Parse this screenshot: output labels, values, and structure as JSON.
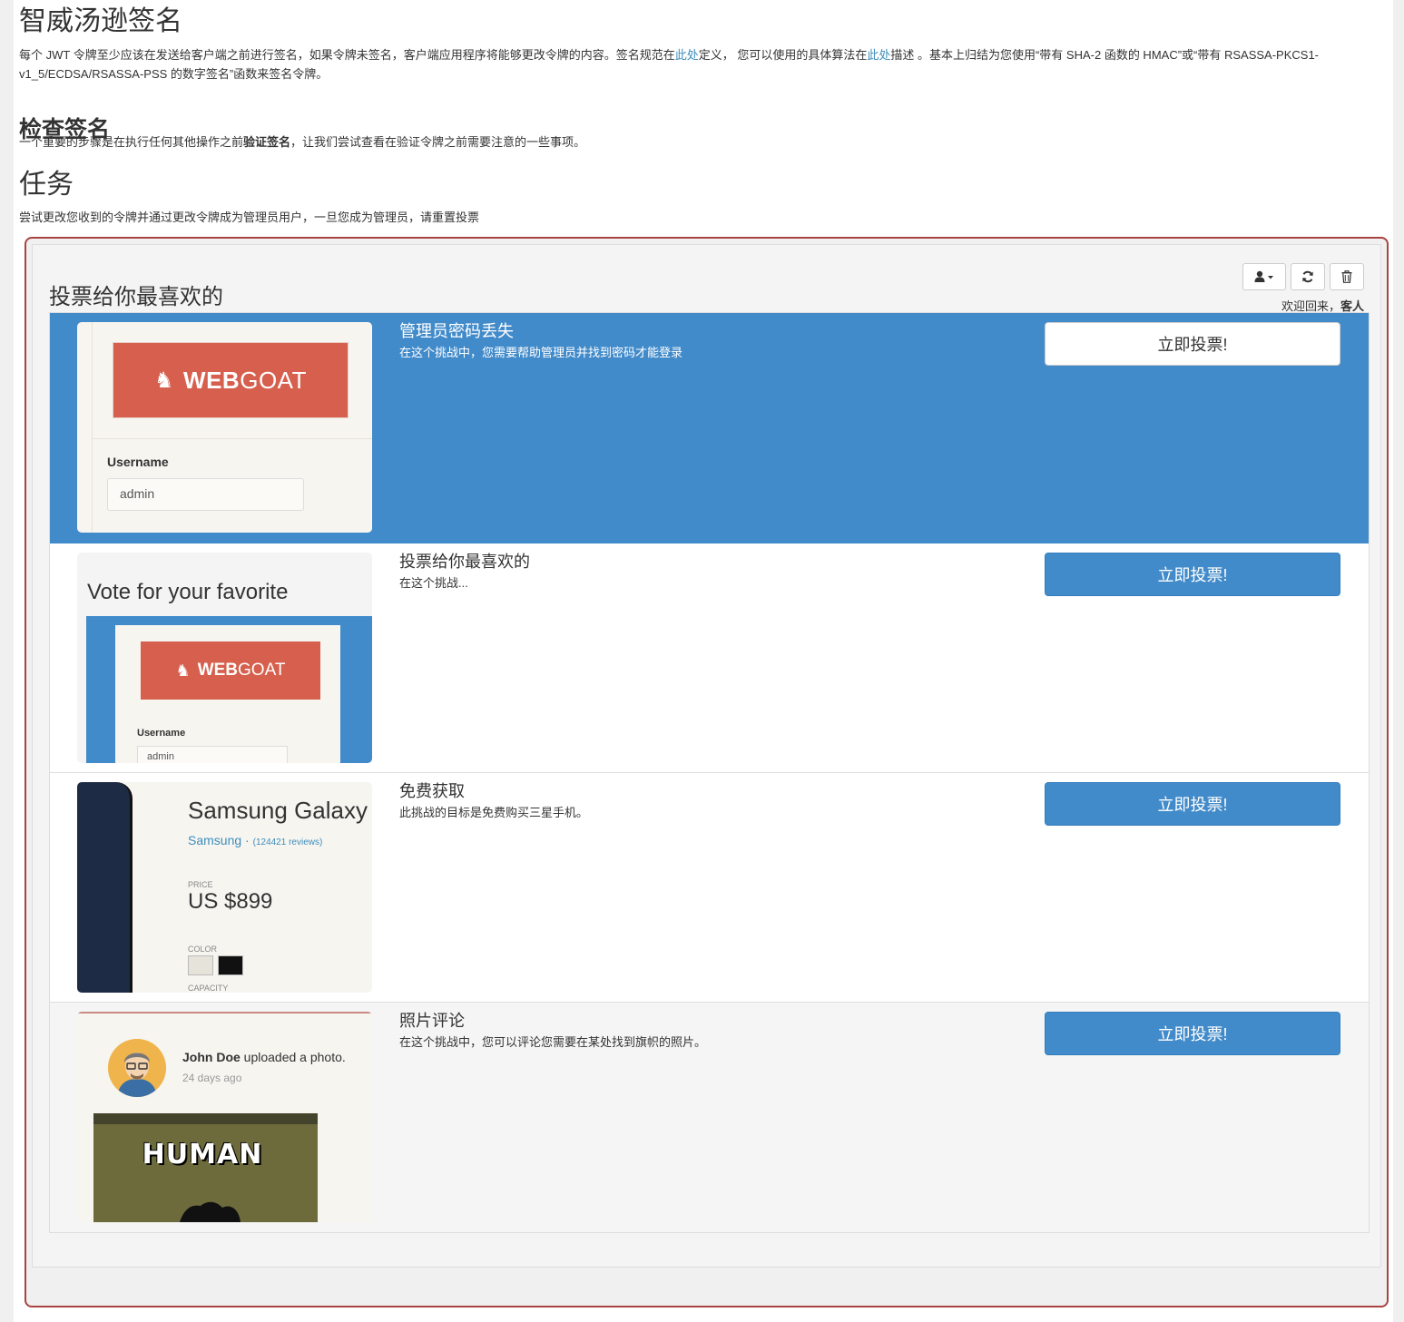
{
  "intro": {
    "title": "智威汤逊签名",
    "para_a": "每个 JWT 令牌至少应该在发送给客户端之前进行签名，如果令牌未签名，客户端应用程序将能够更改令牌的内容。签名规范在",
    "link_a": "此处",
    "para_b": "定义， 您可以使用的具体算法在",
    "link_b": "此处",
    "para_c": "描述 。基本上归结为您使用“带有 SHA-2 函数的 HMAC”或“带有 RSASSA-PKCS1-v1_5/ECDSA/RSASSA-PSS 的数字签名”函数来签名令牌。"
  },
  "check": {
    "title": "检查签名",
    "para_a": "一个重要的步骤是在执行任何其他操作之前",
    "bold": "验证签名",
    "para_b": "，让我们尝试查看在验证令牌之前需要注意的一些事项。"
  },
  "task": {
    "title": "任务",
    "para": "尝试更改您收到的令牌并通过更改令牌成为管理员用户，一旦您成为管理员，请重置投票"
  },
  "voting": {
    "title": "投票给你最喜欢的",
    "welcome_prefix": "欢迎回来，",
    "welcome_user": "客人",
    "vote_label": "立即投票!",
    "items": [
      {
        "title": "管理员密码丢失",
        "desc": "在这个挑战中，您需要帮助管理员并找到密码才能登录"
      },
      {
        "title": "投票给你最喜欢的",
        "desc": "在这个挑战..."
      },
      {
        "title": "免费获取",
        "desc": "此挑战的目标是免费购买三星手机。"
      },
      {
        "title": "照片评论",
        "desc": "在这个挑战中，您可以评论您需要在某处找到旗帜的照片。"
      }
    ]
  },
  "thumbs": {
    "logo_bold": "WEB",
    "logo_rest": "GOAT",
    "username_label": "Username",
    "username_value": "admin",
    "vote_heading": "Vote for your favorite",
    "phone_name": "Samsung Galaxy",
    "phone_brand": "Samsung",
    "phone_reviews": "(124421 reviews)",
    "price_label": "PRICE",
    "price": "US $899",
    "color_label": "COLOR",
    "capacity_label": "CAPACITY",
    "poster_name": "John Doe",
    "poster_action": " uploaded a photo.",
    "poster_time": "24 days ago",
    "photo_caption": "HUMAN"
  },
  "colors": {
    "primary": "#428bca",
    "danger_border": "#a94442",
    "logo": "#d6604d"
  },
  "icons": [
    "user-icon",
    "caret-down-icon",
    "refresh-icon",
    "trash-icon"
  ]
}
